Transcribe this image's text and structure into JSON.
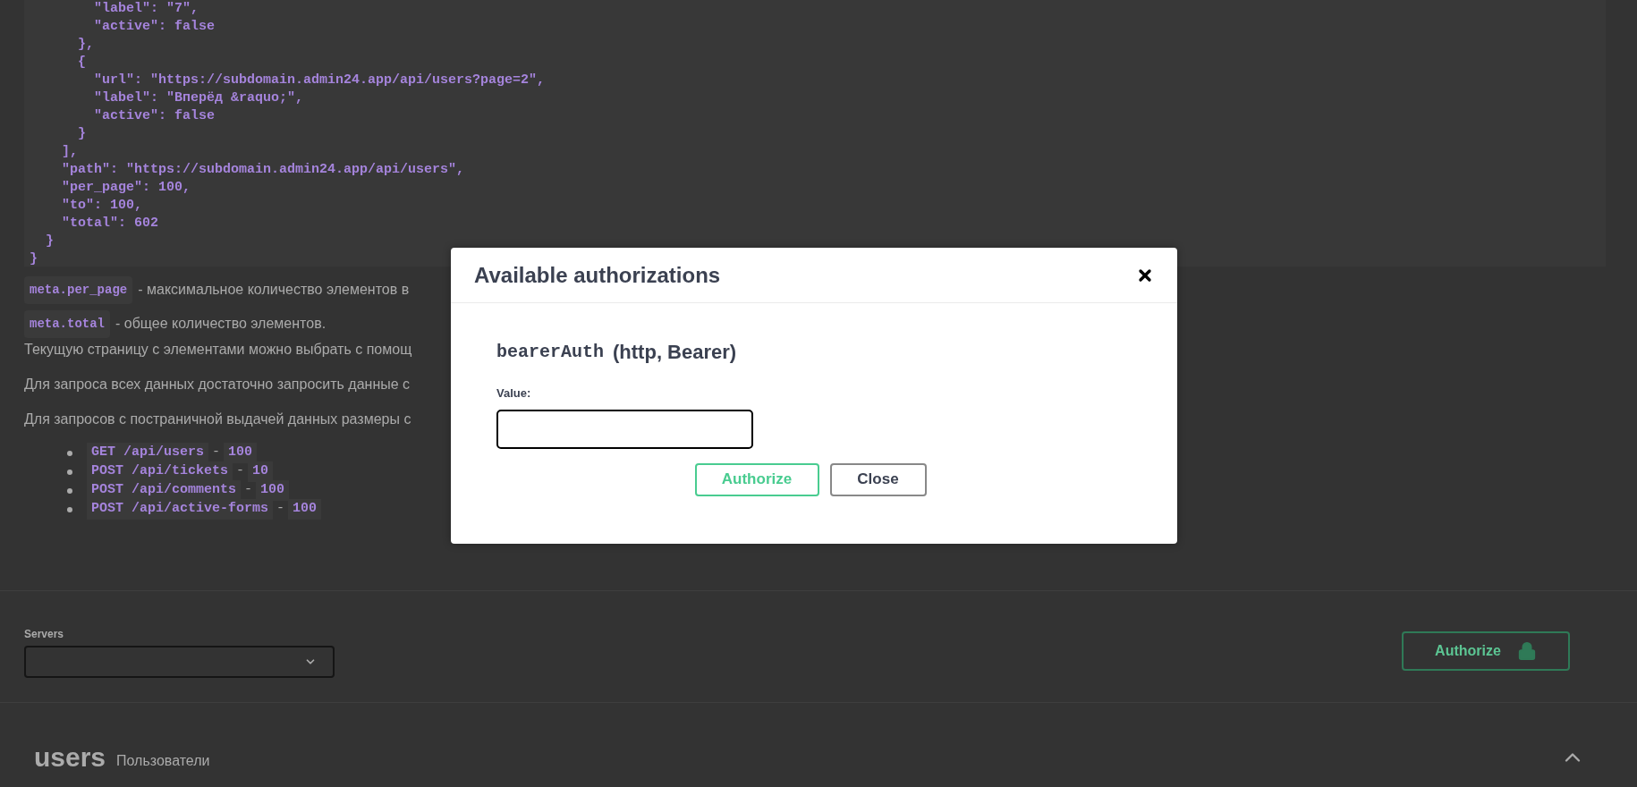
{
  "code_block": {
    "lines": [
      "        \"label\": \"7\",",
      "        \"active\": false",
      "      },",
      "      {",
      "        \"url\": \"https://subdomain.admin24.app/api/users?page=2\",",
      "        \"label\": \"Вперёд &raquo;\",",
      "        \"active\": false",
      "      }",
      "    ],",
      "    \"path\": \"https://subdomain.admin24.app/api/users\",",
      "    \"per_page\": 100,",
      "    \"to\": 100,",
      "    \"total\": 602",
      "  }",
      "}"
    ]
  },
  "notes": [
    {
      "code": "meta.per_page",
      "text": "- максимальное количество элементов в"
    },
    {
      "code": "meta.total",
      "text": "- общее количество элементов."
    }
  ],
  "paragraphs": [
    "Текущую страницу с элементами можно выбрать с помощ",
    "Для запроса всех данных достаточно запросить данные с",
    "Для запросов с постраничной выдачей данных размеры с"
  ],
  "limits": [
    {
      "endpoint": "GET /api/users",
      "separator": "-",
      "value": "100"
    },
    {
      "endpoint": "POST /api/tickets",
      "separator": "-",
      "value": "10"
    },
    {
      "endpoint": "POST /api/comments",
      "separator": "-",
      "value": "100"
    },
    {
      "endpoint": "POST /api/active-forms",
      "separator": "-",
      "value": "100"
    }
  ],
  "servers": {
    "label": "Servers"
  },
  "authorize_button": {
    "label": "Authorize"
  },
  "section": {
    "title": "users",
    "description": "Пользователи",
    "expanded": true
  },
  "modal": {
    "title": "Available authorizations",
    "scheme": {
      "name": "bearerAuth",
      "type": "(http, Bearer)"
    },
    "field_label": "Value:",
    "buttons": [
      {
        "label": "Authorize",
        "kind": "primary"
      },
      {
        "label": "Close",
        "kind": "secondary"
      }
    ]
  }
}
